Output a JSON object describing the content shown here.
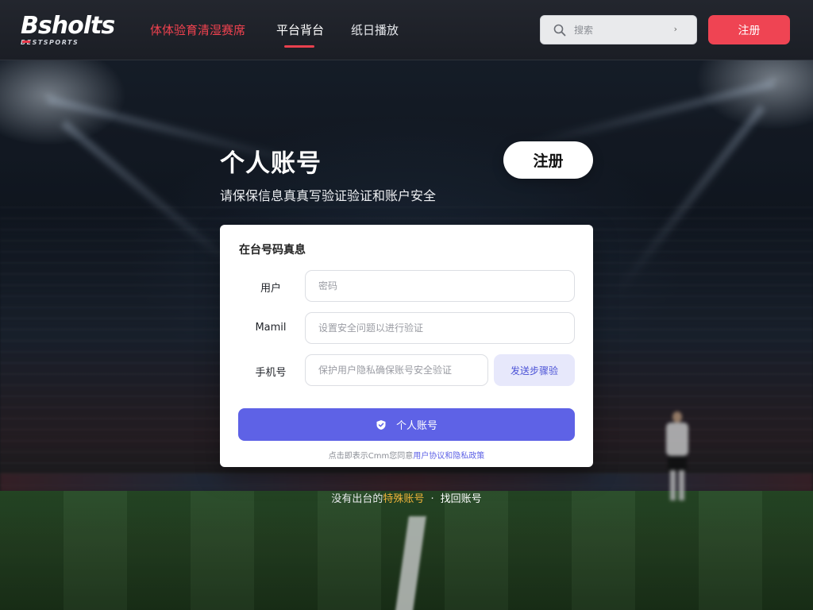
{
  "header": {
    "logo_text": "Bsholts",
    "logo_subtext": "BESTSPORTS",
    "nav": {
      "brand": "体体验育清湿赛席",
      "platform": "平台背台",
      "records": "纸日播放"
    },
    "search": {
      "placeholder": "搜索",
      "caret": "›"
    },
    "register_label": "注册"
  },
  "hero": {
    "title": "个人账号",
    "subtitle": "请保保信息真真写验证验证和账户安全",
    "register_label": "注册"
  },
  "form": {
    "heading": "在台号码真息",
    "fields": {
      "user": {
        "label": "用户",
        "placeholder": "密码"
      },
      "email": {
        "label": "Mamil",
        "placeholder": "设置安全问题以进行验证"
      },
      "phone": {
        "label": "手机号",
        "placeholder": "保护用户隐私确保账号安全验证"
      }
    },
    "code_button": "发送步骤验",
    "submit_label": "个人账号",
    "note_prefix": "点击即表示Cmm您同意",
    "note_link": "用户协议和隐私政策"
  },
  "footer": {
    "prefix": "没有出台的",
    "accent": "特殊账号",
    "dot": "·",
    "link": "找回账号"
  },
  "colors": {
    "brand_red": "#ef4453",
    "primary": "#5e62e6",
    "primary_light": "#e7e8fb",
    "accent_gold": "#f0b43a"
  },
  "icons": [
    "search-icon",
    "shield-icon"
  ]
}
